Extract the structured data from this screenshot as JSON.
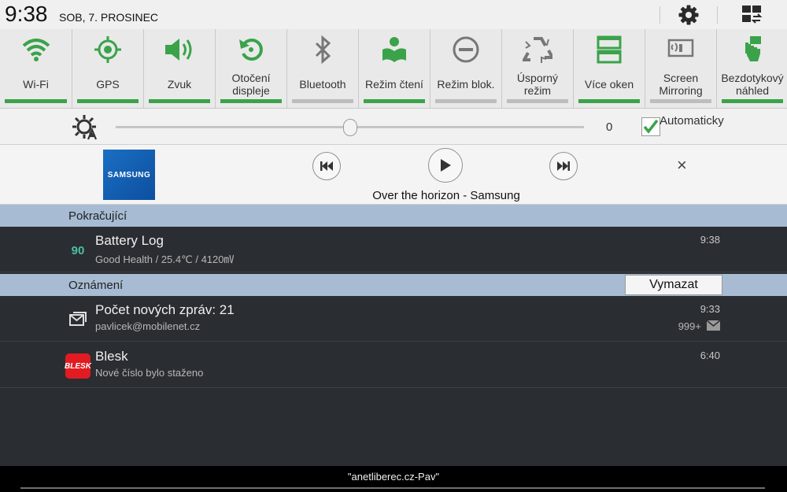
{
  "status": {
    "time": "9:38",
    "date": "SOB, 7. PROSINEC"
  },
  "toggles": [
    {
      "label": "Wi-Fi",
      "icon": "wifi-icon",
      "on": true
    },
    {
      "label": "GPS",
      "icon": "gps-icon",
      "on": true
    },
    {
      "label": "Zvuk",
      "icon": "sound-icon",
      "on": true
    },
    {
      "label": "Otočení displeje",
      "icon": "rotate-icon",
      "on": true
    },
    {
      "label": "Bluetooth",
      "icon": "bluetooth-icon",
      "on": false
    },
    {
      "label": "Režim čtení",
      "icon": "reading-mode-icon",
      "on": true
    },
    {
      "label": "Režim blok.",
      "icon": "blocking-mode-icon",
      "on": false
    },
    {
      "label": "Úsporný režim",
      "icon": "power-saving-icon",
      "on": false
    },
    {
      "label": "Více oken",
      "icon": "multi-window-icon",
      "on": true
    },
    {
      "label": "Screen Mirroring",
      "icon": "screen-mirroring-icon",
      "on": false
    },
    {
      "label": "Bezdotykový náhled",
      "icon": "air-view-icon",
      "on": true
    }
  ],
  "brightness": {
    "value": "0",
    "level": 0.5,
    "auto_label": "Automaticky",
    "auto_checked": true
  },
  "media": {
    "album_text": "SAMSUNG",
    "track": "Over the horizon - Samsung",
    "close": "×"
  },
  "ongoing": {
    "header": "Pokračující",
    "items": [
      {
        "badge": "90",
        "title": "Battery Log",
        "subtitle": "Good Health / 25.4℃ / 4120㎷",
        "time": "9:38"
      }
    ]
  },
  "notifications": {
    "header": "Oznámení",
    "clear_label": "Vymazat",
    "items": [
      {
        "title": "Počet nových zpráv: 21",
        "subtitle": "pavlicek@mobilenet.cz",
        "time": "9:33",
        "count": "999+"
      },
      {
        "logo_text": "BLESK",
        "title": "Blesk",
        "subtitle": "Nové číslo bylo staženo",
        "time": "6:40"
      }
    ]
  },
  "carrier": "\"anetliberec.cz-Pav\"",
  "colors": {
    "accent_green": "#3aa34a",
    "section_blue": "#a7bcd3",
    "panel_dark": "#2a2d31"
  }
}
